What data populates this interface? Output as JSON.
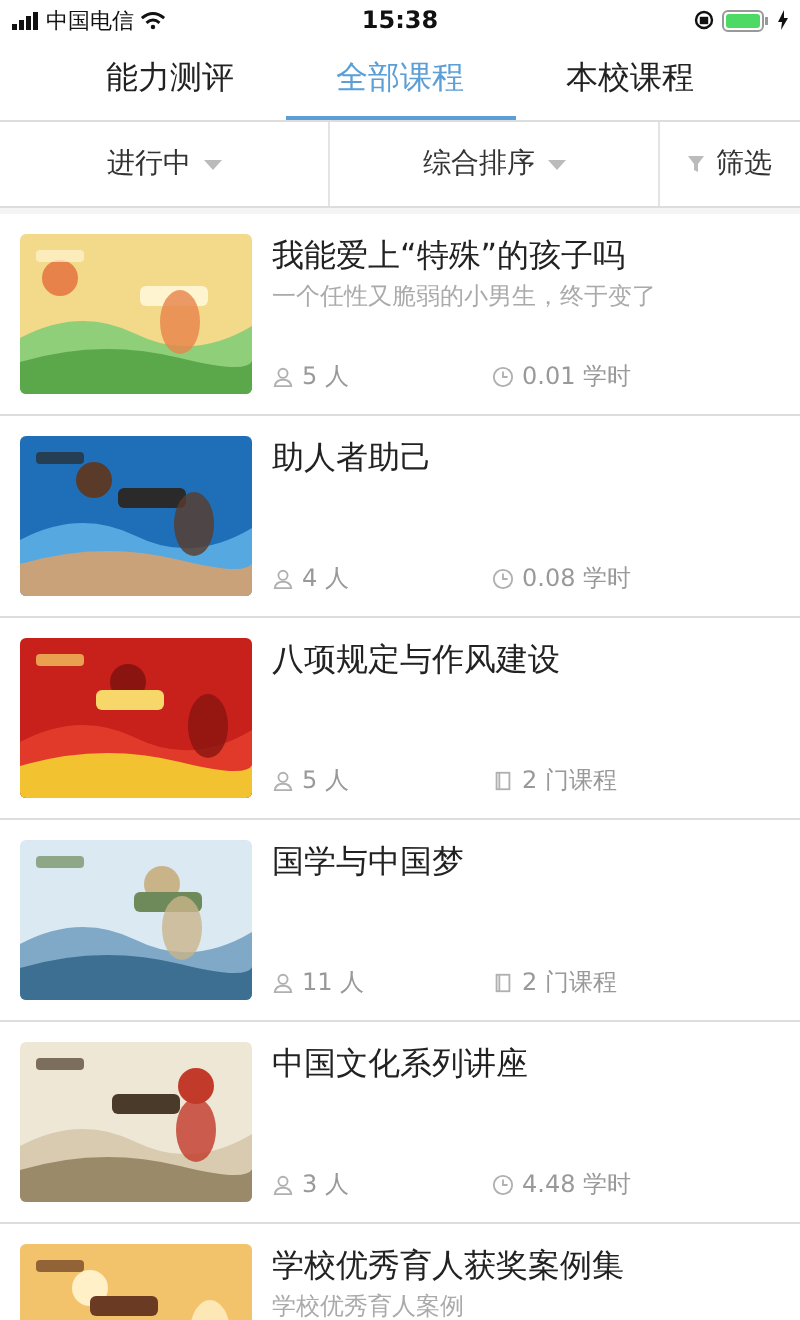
{
  "status_bar": {
    "carrier": "中国电信",
    "time": "15:38"
  },
  "tabs": [
    {
      "label": "能力测评",
      "selected": false
    },
    {
      "label": "全部课程",
      "selected": true
    },
    {
      "label": "本校课程",
      "selected": false
    }
  ],
  "filters": [
    {
      "label": "进行中",
      "kind": "dropdown"
    },
    {
      "label": "综合排序",
      "kind": "dropdown"
    },
    {
      "label": "筛选",
      "kind": "filter"
    }
  ],
  "courses": [
    {
      "title": "我能爱上“特殊”的孩子吗",
      "subtitle": "一个任性又脆弱的小男生，终于变了",
      "people": "5 人",
      "meta": {
        "kind": "hours",
        "text": "0.01 学时"
      }
    },
    {
      "title": "助人者助己",
      "people": "4 人",
      "meta": {
        "kind": "hours",
        "text": "0.08 学时"
      }
    },
    {
      "title": "八项规定与作风建设",
      "people": "5 人",
      "meta": {
        "kind": "courses",
        "text": "2 门课程"
      }
    },
    {
      "title": "国学与中国梦",
      "people": "11 人",
      "meta": {
        "kind": "courses",
        "text": "2 门课程"
      }
    },
    {
      "title": "中国文化系列讲座",
      "people": "3 人",
      "meta": {
        "kind": "hours",
        "text": "4.48 学时"
      }
    },
    {
      "title": "学校优秀育人获奖案例集",
      "subtitle": "学校优秀育人案例"
    }
  ]
}
